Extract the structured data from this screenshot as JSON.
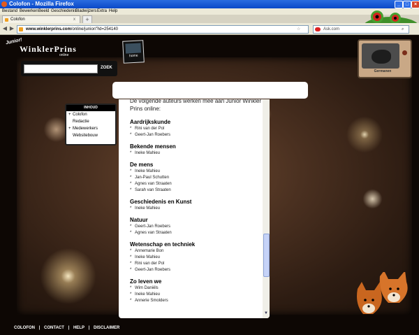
{
  "window": {
    "title": "Colofon - Mozilla Firefox"
  },
  "menu": [
    "Bestand",
    "Bewerken",
    "Beeld",
    "Geschiedenis",
    "Bladwijzers",
    "Extra",
    "Help"
  ],
  "tab": {
    "label": "Colofon",
    "close": "x",
    "new": "+"
  },
  "nav": {
    "url_host": "www.winklerprins.com",
    "url_path": "/online/junior/?id=254140",
    "search_placeholder": "Ask.com"
  },
  "site": {
    "logo_junior": "Junior!",
    "logo_name": "WinklerPrins",
    "logo_online": "online",
    "home_label": "home",
    "search_button": "ZOEK",
    "tv_caption": "Germanen"
  },
  "inhoud": {
    "title": "INHOUD",
    "items": [
      "Colofon",
      "Redactie",
      "Medewerkers",
      "Websitebouw"
    ]
  },
  "content": {
    "intro": "De volgende auteurs werken mee aan Junior Winkler Prins online:",
    "sections": [
      {
        "title": "Aardrijkskunde",
        "names": [
          "Rini van der Pol",
          "Geert-Jan Roebers"
        ]
      },
      {
        "title": "Bekende mensen",
        "names": [
          "Ineke Mahieu"
        ]
      },
      {
        "title": "De mens",
        "names": [
          "Ineke Mahieu",
          "Jan-Paul Schutten",
          "Agnes van Straaten",
          "Sarah van Straaten"
        ]
      },
      {
        "title": "Geschiedenis en Kunst",
        "names": [
          "Ineke Mahieu"
        ]
      },
      {
        "title": "Natuur",
        "names": [
          "Geert-Jan Roebers",
          "Agnes van Straaten"
        ]
      },
      {
        "title": "Wetenschap en techniek",
        "names": [
          "Annemarie Bon",
          "Ineke Mahieu",
          "Rini van der Pol",
          "Geert-Jan Roebers"
        ]
      },
      {
        "title": "Zo leven we",
        "names": [
          "Wim Daniëls",
          "Ineke Mahieu",
          "Annerie Smolders"
        ]
      }
    ]
  },
  "footer": [
    "COLOFON",
    "|",
    "CONTACT",
    "|",
    "HELP",
    "|",
    "DISCLAIMER"
  ]
}
